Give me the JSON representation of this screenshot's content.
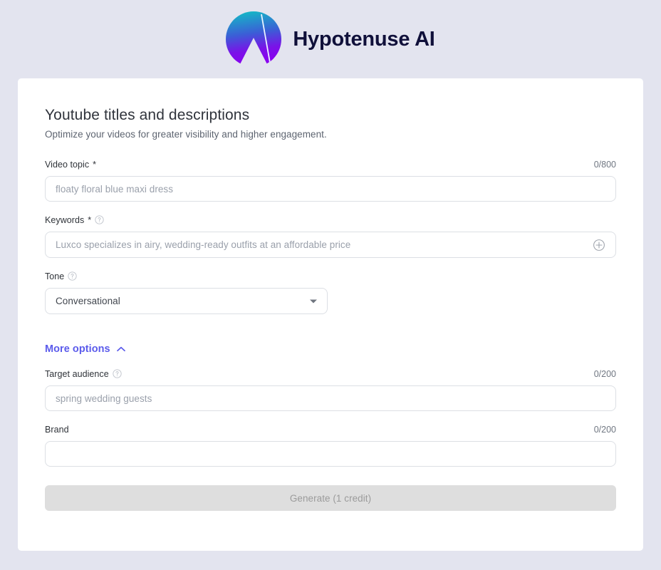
{
  "brand": {
    "name": "Hypotenuse AI",
    "logo_icon": "hypotenuse-logo-icon",
    "logo_gradient_top": "#0fbfbf",
    "logo_gradient_bottom": "#7a00e0",
    "name_color": "#10103a"
  },
  "page": {
    "background_color": "#e3e4ef",
    "card_background_color": "#ffffff",
    "title": "Youtube titles and descriptions",
    "subtitle": "Optimize your videos for greater visibility and higher engagement."
  },
  "form": {
    "video_topic": {
      "label": "Video topic",
      "required_marker": "*",
      "counter": "0/800",
      "placeholder": "floaty floral blue maxi dress",
      "value": ""
    },
    "keywords": {
      "label": "Keywords",
      "required_marker": "*",
      "help_icon": "help-circle-icon",
      "placeholder": "Luxco specializes in airy, wedding-ready outfits at an affordable price",
      "value": "",
      "add_icon": "plus-circle-icon"
    },
    "tone": {
      "label": "Tone",
      "help_icon": "help-circle-icon",
      "selected": "Conversational",
      "caret_icon": "chevron-down-icon"
    },
    "more_options": {
      "label": "More options",
      "chevron_icon": "chevron-up-icon",
      "color": "#5b5beb",
      "expanded": true
    },
    "target_audience": {
      "label": "Target audience",
      "help_icon": "help-circle-icon",
      "counter": "0/200",
      "placeholder": "spring wedding guests",
      "value": ""
    },
    "brand_field": {
      "label": "Brand",
      "counter": "0/200",
      "placeholder": "",
      "value": ""
    },
    "generate_button": {
      "label": "Generate (1 credit)",
      "disabled": true,
      "background_color": "#dedede",
      "text_color": "#9b9b9b"
    }
  }
}
